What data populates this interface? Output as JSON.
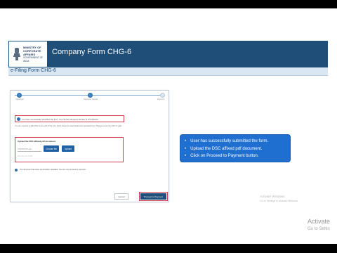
{
  "header": {
    "ministry_line1": "MINISTRY OF",
    "ministry_line2": "CORPORATE",
    "ministry_line3": "AFFAIRS",
    "ministry_gov": "GOVERNMENT OF INDIA",
    "title": "Company Form CHG-6",
    "brand_color": "#1f4e79",
    "emblem_icon": "national-emblem-icon"
  },
  "subheader": {
    "label": "e-Filing Form CHG-6"
  },
  "form": {
    "steps": [
      {
        "label": "Submitted",
        "state": "complete"
      },
      {
        "label": "Signature Upload",
        "state": "complete"
      },
      {
        "label": "Payment",
        "state": "pending"
      }
    ],
    "success_message": "You have successfully submitted the form. Your Service Request Number is XXXXXXXX",
    "info_text": "You are required to affix DSC on the pdf of the form which has to be downloaded and uploaded here. Please ensure the DSC is valid.",
    "upload": {
      "title": "Upload the DSC affixed pdf document",
      "file_placeholder": "XXXXXXXX.pdf",
      "choose_label": "Choose file",
      "upload_label": "Upload",
      "hint": "Max file size 6 MB"
    },
    "note": "The document has been successfully uploaded. You can now proceed to payment.",
    "cancel_label": "Cancel",
    "proceed_label": "Proceed to Payment"
  },
  "callout": {
    "items": [
      "User has successfully submitted the form.",
      "Upload the DSC affixed pdf document.",
      "Click on Proceed to Payment button."
    ],
    "color": "#1f6fd0"
  },
  "watermark": {
    "line1": "Activate Windows",
    "line2": "Go to Settings to activate Windows.",
    "line3": "Activate",
    "line4": "Go to Settin"
  }
}
